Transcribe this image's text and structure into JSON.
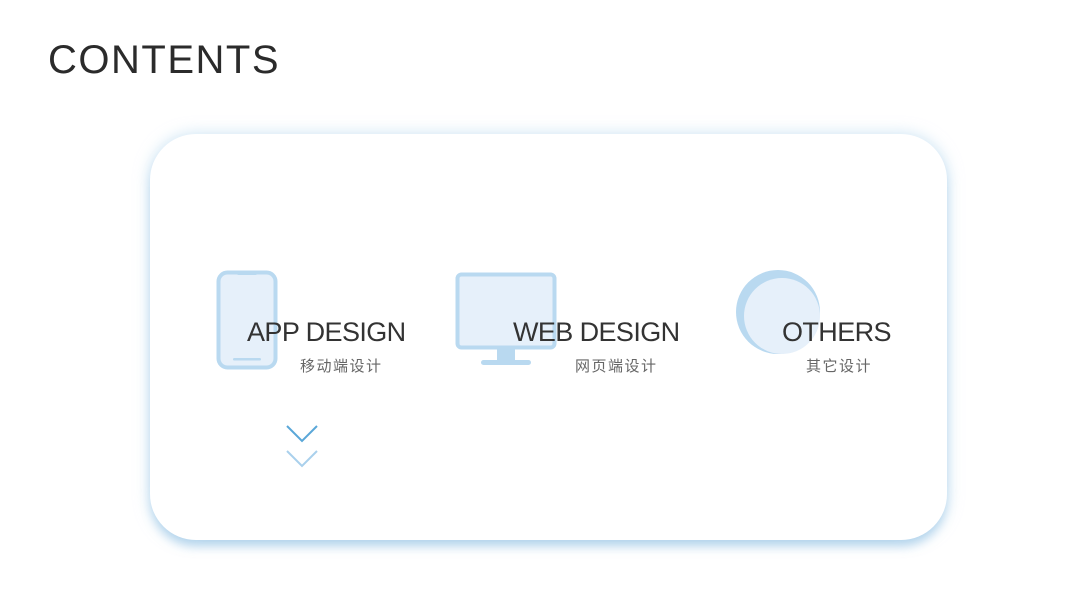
{
  "page": {
    "title": "CONTENTS"
  },
  "items": [
    {
      "title": "APP DESIGN",
      "subtitle": "移动端设计",
      "icon": "smartphone-icon"
    },
    {
      "title": "WEB DESIGN",
      "subtitle": "网页端设计",
      "icon": "desktop-monitor-icon"
    },
    {
      "title": "OTHERS",
      "subtitle": "其它设计",
      "icon": "circle-icon"
    }
  ],
  "controls": {
    "icon": "double-chevron-down-icon"
  },
  "colors": {
    "accent": "#5aa7d8",
    "icon_fill": "#e6f0fa",
    "icon_stroke": "#b9d9f0",
    "text_dark": "#333333",
    "text_sub": "#666666",
    "card_shadow": "#b4d6ee"
  }
}
